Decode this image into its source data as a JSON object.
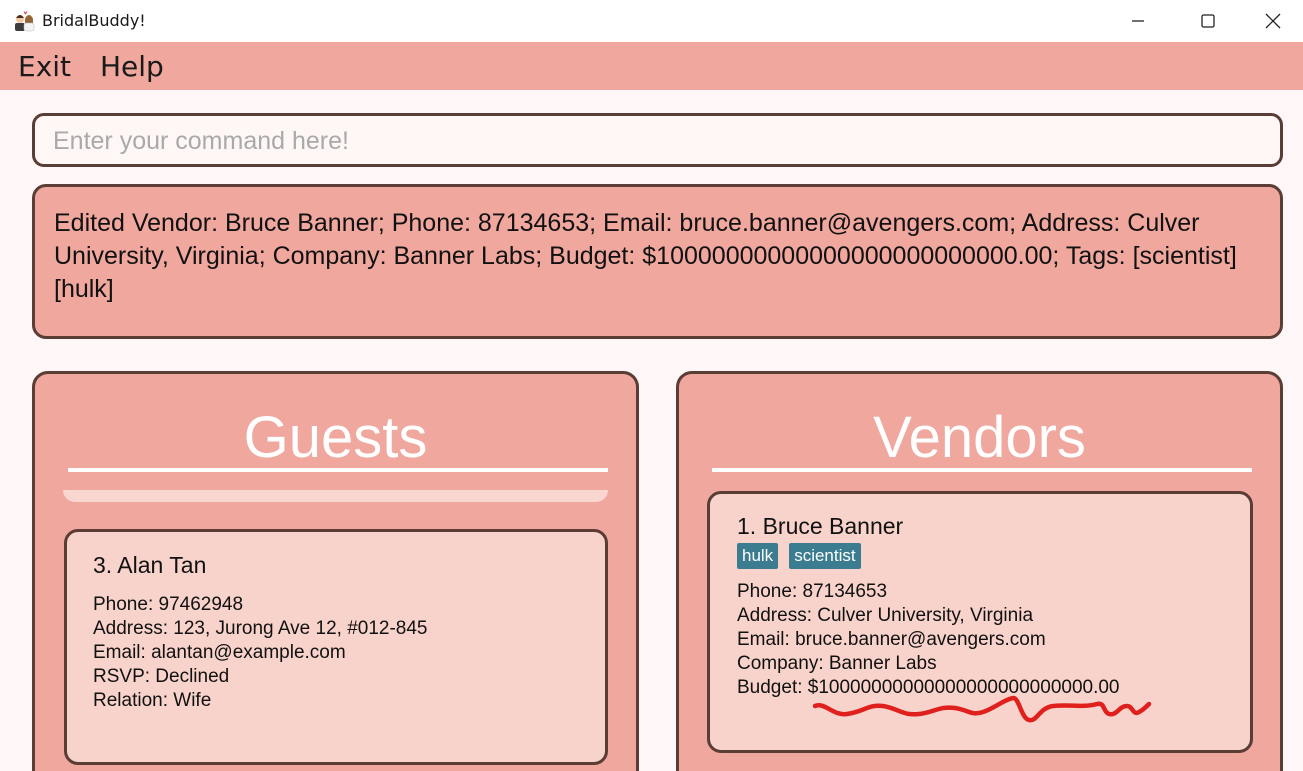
{
  "window": {
    "title": "BridalBuddy!",
    "icon": "couple-icon"
  },
  "menu": {
    "exit_label": "Exit",
    "help_label": "Help"
  },
  "command": {
    "placeholder": "Enter your command here!",
    "value": ""
  },
  "result": {
    "text": "Edited Vendor: Bruce Banner; Phone: 87134653; Email: bruce.banner@avengers.com; Address: Culver University, Virginia; Company: Banner Labs; Budget: $10000000000000000000000000.00; Tags: [scientist][hulk]"
  },
  "guests": {
    "title": "Guests",
    "items": [
      {
        "name": "3. Alan Tan",
        "phone": "Phone: 97462948",
        "address": "Address: 123, Jurong Ave 12, #012-845",
        "email": "Email: alantan@example.com",
        "rsvp": "RSVP: Declined",
        "relation": "Relation: Wife"
      }
    ]
  },
  "vendors": {
    "title": "Vendors",
    "items": [
      {
        "name": "1. Bruce Banner",
        "tags": [
          "hulk",
          "scientist"
        ],
        "phone": "Phone: 87134653",
        "address": "Address: Culver University, Virginia",
        "email": "Email: bruce.banner@avengers.com",
        "company": "Company: Banner Labs",
        "budget": "Budget: $10000000000000000000000000.00"
      }
    ]
  },
  "colors": {
    "accent": "#f0a79e",
    "card": "#f8d3cb",
    "border": "#5a3d35",
    "tag": "#3b7c90",
    "annotation": "#e0201c"
  }
}
